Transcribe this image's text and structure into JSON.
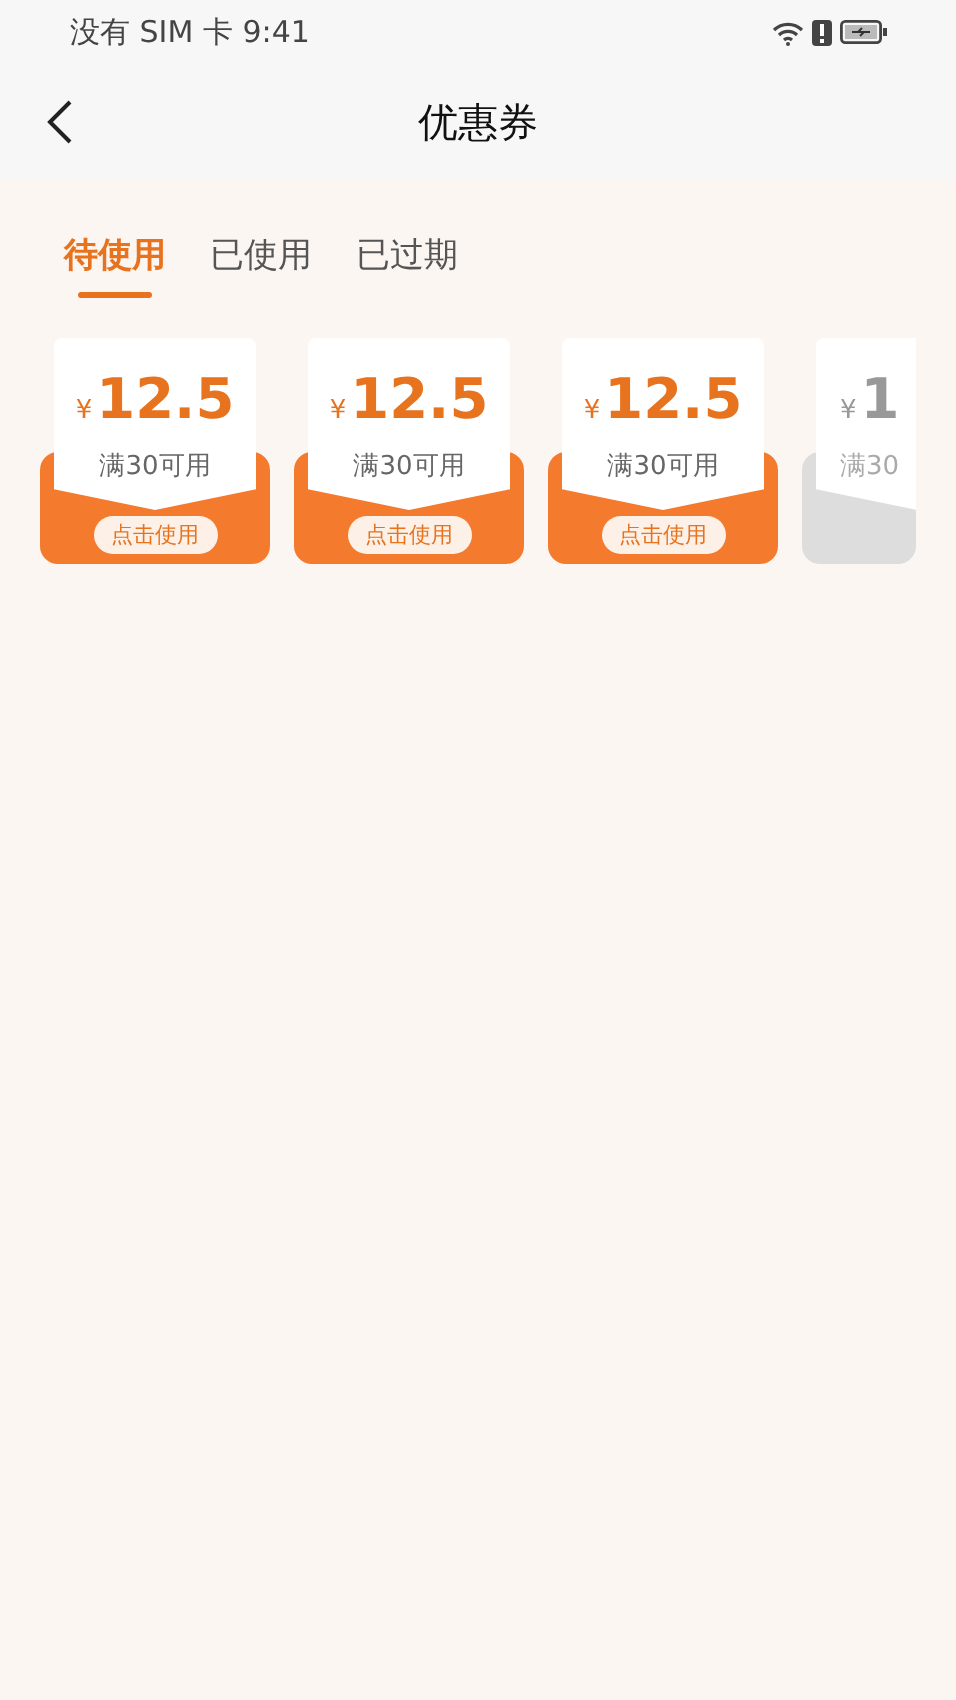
{
  "status_bar": {
    "carrier": "没有 SIM 卡",
    "time": "9:41"
  },
  "header": {
    "title": "优惠券"
  },
  "tabs": [
    {
      "label": "待使用",
      "selected": true
    },
    {
      "label": "已使用",
      "selected": false
    },
    {
      "label": "已过期",
      "selected": false
    }
  ],
  "coupons": [
    {
      "kind": "active",
      "currency": "¥",
      "amount": "12.5",
      "condition": "满30可用",
      "action": "点击使用"
    },
    {
      "kind": "active",
      "currency": "¥",
      "amount": "12.5",
      "condition": "满30可用",
      "action": "点击使用"
    },
    {
      "kind": "active",
      "currency": "¥",
      "amount": "12.5",
      "condition": "满30可用",
      "action": "点击使用"
    },
    {
      "kind": "inactive",
      "currency": "¥",
      "amount": "1",
      "condition": "满30"
    }
  ]
}
